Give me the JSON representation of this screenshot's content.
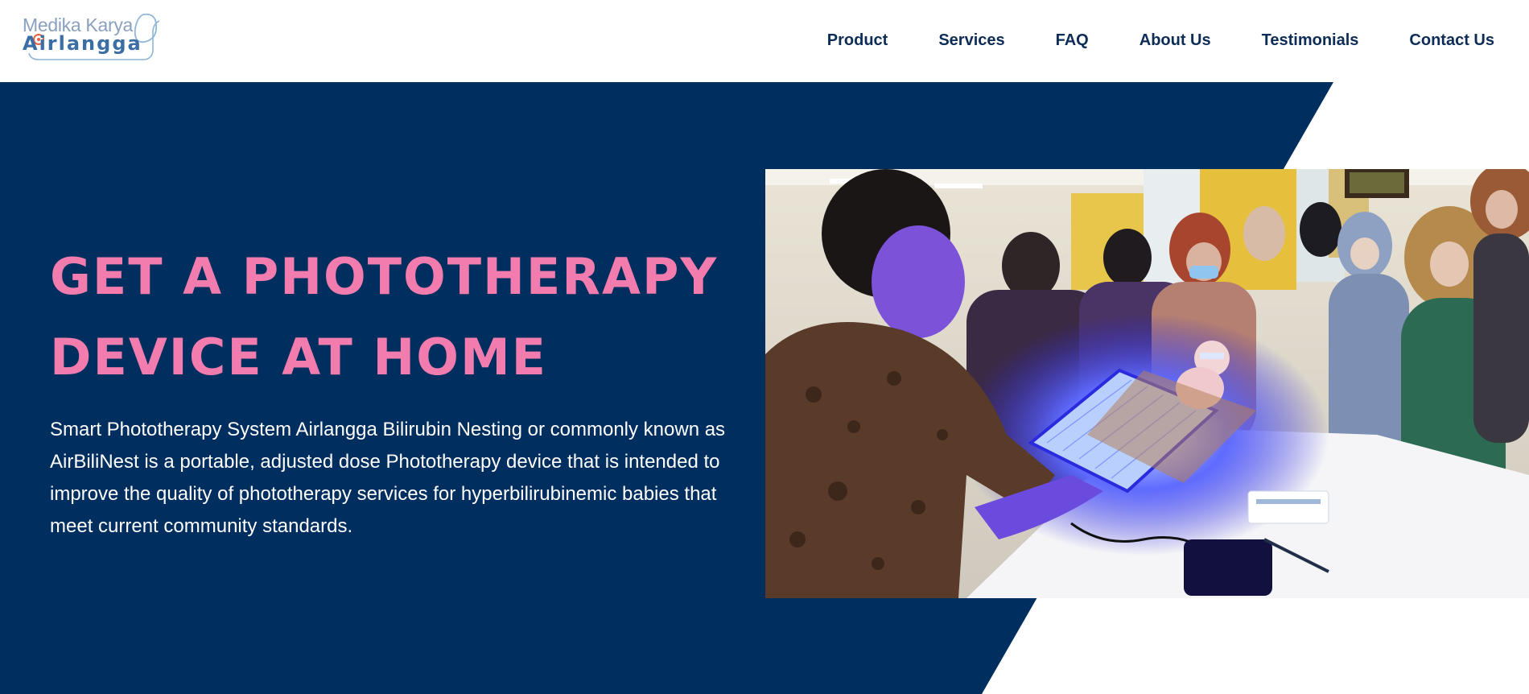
{
  "brand": {
    "name_top": "Medika Karya",
    "name_bottom": "Airlangga",
    "icon": "stethoscope-icon",
    "colors": {
      "top": "#8aa0bf",
      "bottom": "#3a6ea5",
      "accent": "#e8603c"
    }
  },
  "nav": {
    "items": [
      {
        "label": "Product"
      },
      {
        "label": "Services"
      },
      {
        "label": "FAQ"
      },
      {
        "label": "About Us"
      },
      {
        "label": "Testimonials"
      },
      {
        "label": "Contact Us"
      }
    ]
  },
  "hero": {
    "title_line1": "GET A PHOTOTHERAPY",
    "title_line2": "DEVICE AT HOME",
    "description": "Smart Phototherapy System Airlangga Bilirubin Nesting or commonly known as AirBiliNest is a portable, adjusted dose Phototherapy device that is intended to improve the quality of phototherapy services for hyperbilirubinemic babies that meet current community standards.",
    "photo_subject": "phototherapy-device-demonstration-photo"
  },
  "colors": {
    "navy": "#002e5f",
    "title_pink": "#f27cae",
    "nav_text": "#0d2d57",
    "white": "#ffffff"
  }
}
